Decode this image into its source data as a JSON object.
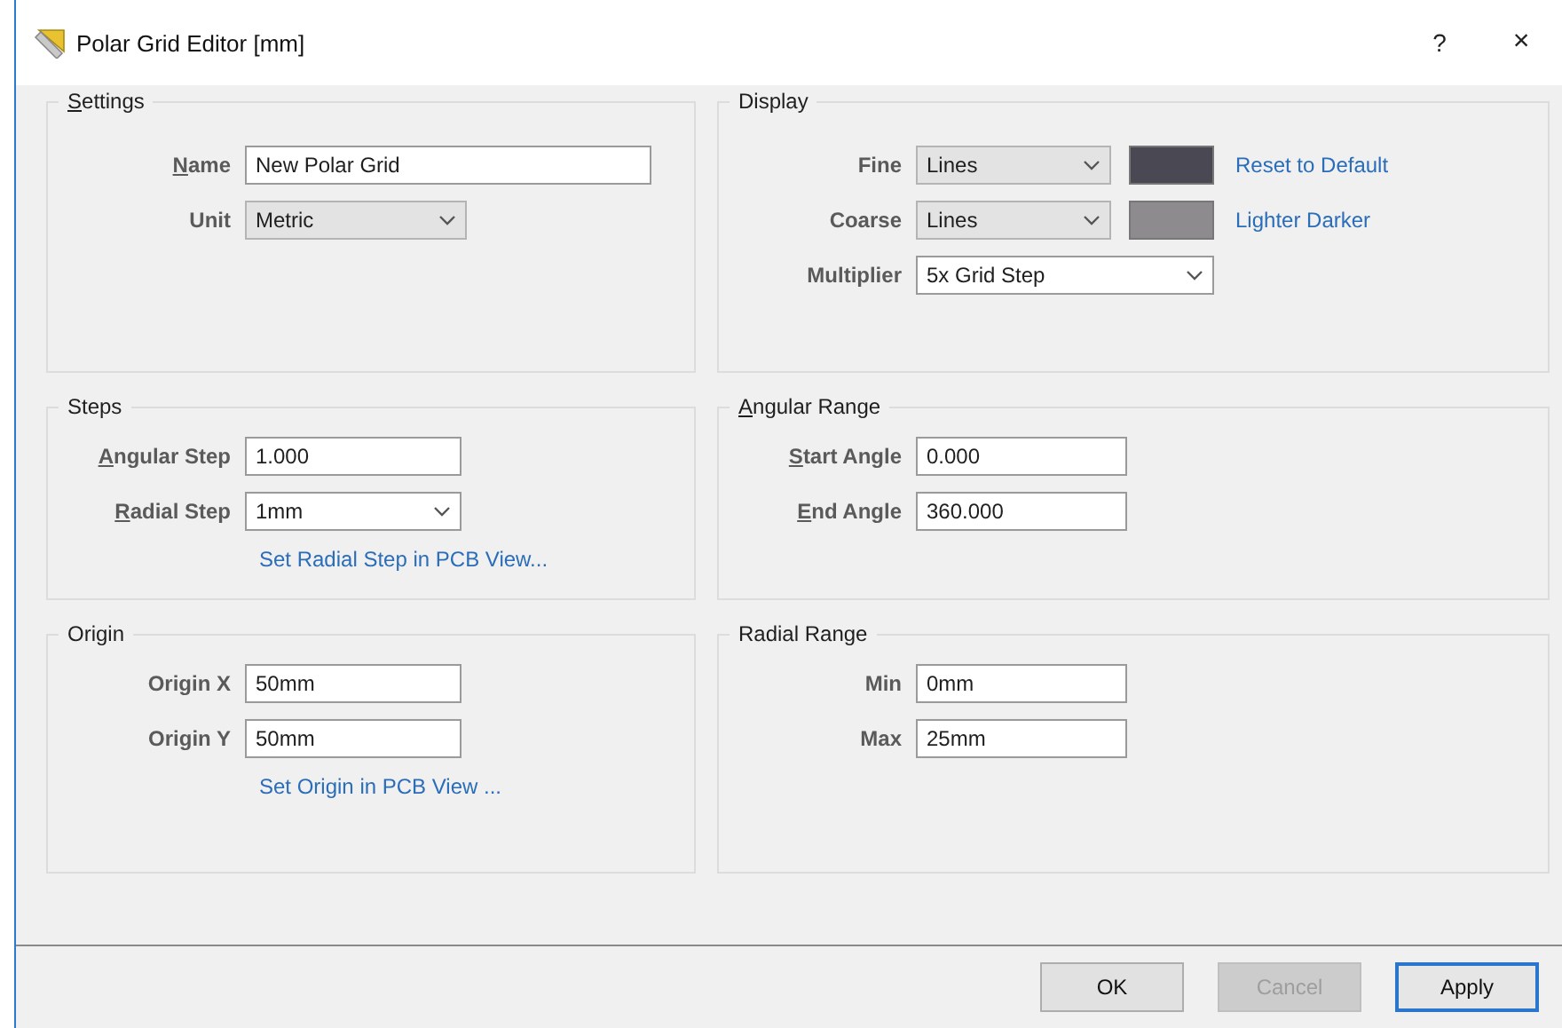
{
  "window": {
    "title": "Polar Grid Editor [mm]",
    "help": "?",
    "close": "×"
  },
  "groups": [
    {
      "title": "Settings",
      "underline_first": true,
      "fields": [
        {
          "kind": "text",
          "label": "Name",
          "underline_first": true,
          "value": "New Polar Grid"
        },
        {
          "kind": "dropdown",
          "label": "Unit",
          "underline_first": false,
          "value": "Metric",
          "editable": false
        }
      ]
    },
    {
      "title": "Display",
      "underline_first": false,
      "fields": [
        {
          "kind": "dropdown",
          "label": "Fine",
          "underline_first": false,
          "value": "Lines",
          "editable": false,
          "color": "#4a4953",
          "link": "Reset to Default"
        },
        {
          "kind": "dropdown",
          "label": "Coarse",
          "underline_first": false,
          "value": "Lines",
          "editable": false,
          "color": "#8d8b8d",
          "link": "Lighter Darker"
        },
        {
          "kind": "dropdown",
          "label": "Multiplier",
          "underline_first": false,
          "value": "5x Grid Step",
          "editable": true
        }
      ]
    },
    {
      "title": "Steps",
      "underline_first": false,
      "fields": [
        {
          "kind": "text",
          "label": "Angular Step",
          "underline_first": true,
          "value": "1.000"
        },
        {
          "kind": "dropdown",
          "label": "Radial Step",
          "underline_first": true,
          "value": "1mm",
          "editable": true
        }
      ],
      "link": "Set Radial Step in PCB View..."
    },
    {
      "title": "Angular Range",
      "underline_first": true,
      "fields": [
        {
          "kind": "text",
          "label": "Start Angle",
          "underline_first": true,
          "value": "0.000"
        },
        {
          "kind": "text",
          "label": "End Angle",
          "underline_first": true,
          "value": "360.000"
        }
      ]
    },
    {
      "title": "Origin",
      "underline_first": false,
      "fields": [
        {
          "kind": "text",
          "label": "Origin X",
          "underline_first": false,
          "value": "50mm"
        },
        {
          "kind": "text",
          "label": "Origin Y",
          "underline_first": false,
          "value": "50mm"
        }
      ],
      "link": "Set Origin in PCB View ..."
    },
    {
      "title": "Radial Range",
      "underline_first": false,
      "fields": [
        {
          "kind": "text",
          "label": "Min",
          "underline_first": false,
          "value": "0mm"
        },
        {
          "kind": "text",
          "label": "Max",
          "underline_first": false,
          "value": "25mm"
        }
      ]
    }
  ],
  "buttons": [
    {
      "label": "OK",
      "disabled": false,
      "default": false
    },
    {
      "label": "Cancel",
      "disabled": true,
      "default": false
    },
    {
      "label": "Apply",
      "disabled": false,
      "default": true
    }
  ]
}
